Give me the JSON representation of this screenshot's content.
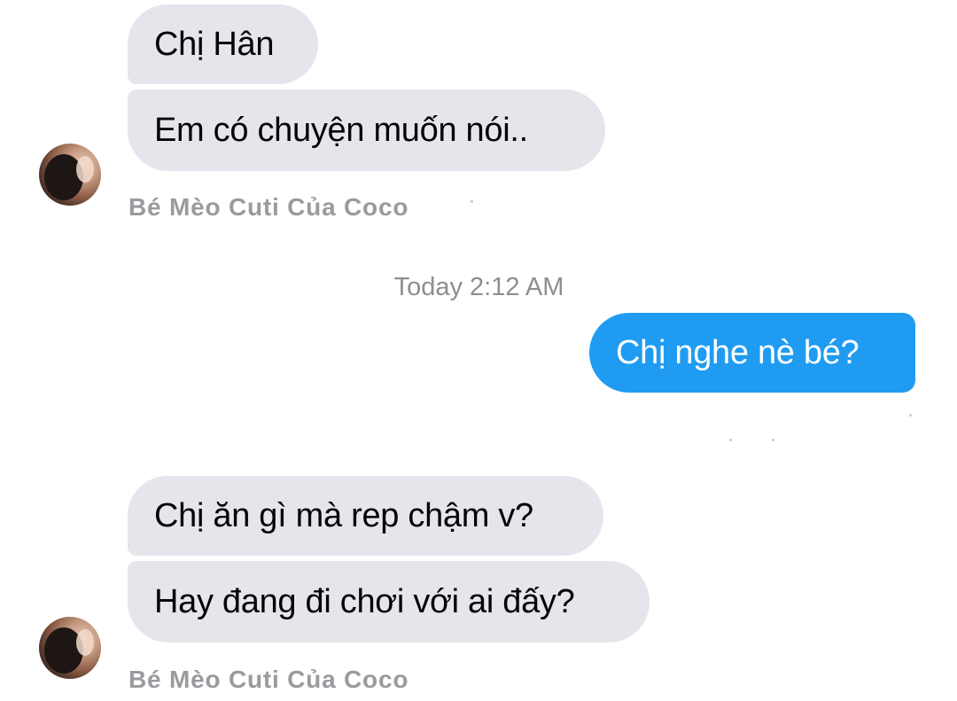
{
  "conversation": {
    "timestamp": "Today 2:12 AM",
    "groups": [
      {
        "sender": "Bé Mèo Cuti Của Coco",
        "messages": [
          "Chị Hân",
          "Em có chuyện muốn nói.."
        ]
      },
      {
        "sender": "Bé Mèo Cuti Của Coco",
        "messages": [
          "Chị ăn gì mà rep chậm v?",
          "Hay đang đi chơi với ai đấy?"
        ]
      }
    ],
    "outgoing": [
      "Chị nghe nè bé?"
    ]
  },
  "colors": {
    "incoming_bubble": "#e4e6eb",
    "outgoing_bubble": "#1f9cf2",
    "sender_label": "#9a9a9f",
    "timestamp": "#8e8e93"
  }
}
